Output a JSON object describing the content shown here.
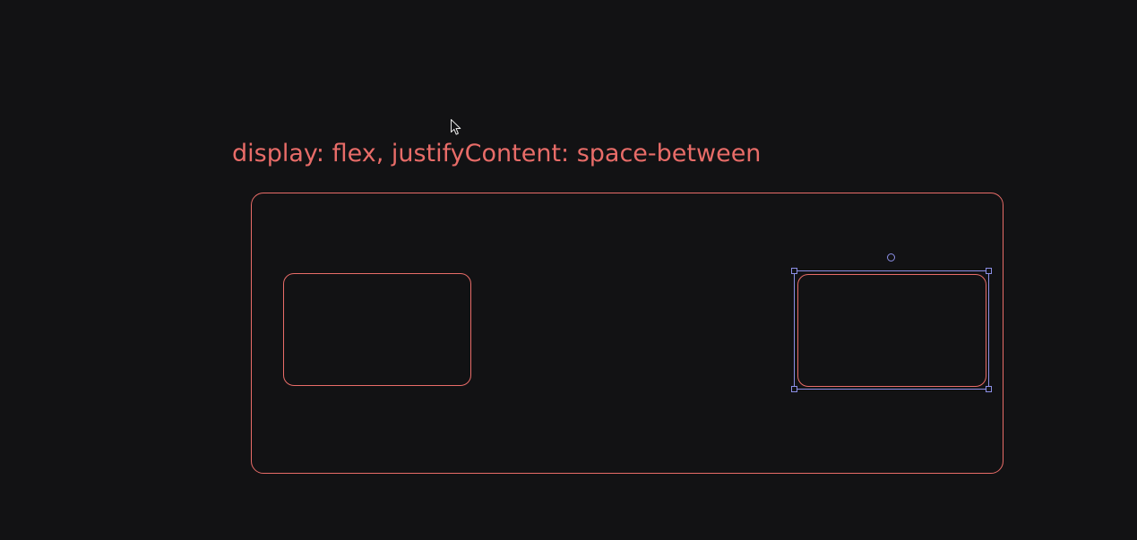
{
  "caption": {
    "text": "display: flex, justifyContent: space-between"
  },
  "colors": {
    "background": "#121214",
    "stroke": "#e86c68",
    "selection": "#8c8fe6",
    "handle_fill": "#121214",
    "cursor_fill": "#121214",
    "cursor_stroke": "#e6e6e6"
  },
  "icons": {
    "cursor": "arrow-cursor-icon",
    "rotate": "rotate-handle-icon"
  }
}
